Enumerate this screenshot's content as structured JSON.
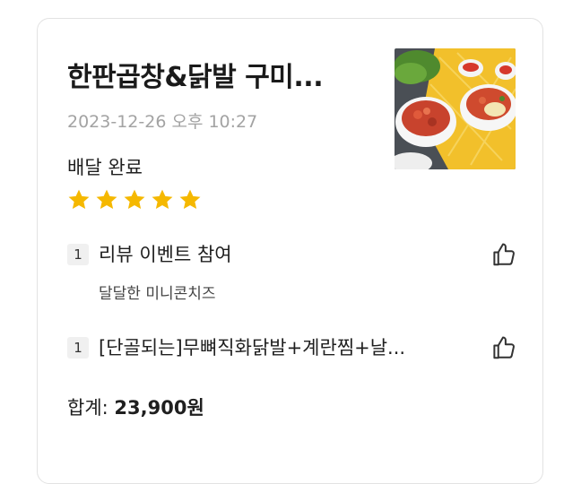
{
  "order": {
    "store_name": "한판곱창&닭발 구미...",
    "date": "2023-12-26 오후 10:27",
    "status": "배달 완료",
    "rating": 5,
    "items": [
      {
        "qty": "1",
        "name": "리뷰 이벤트 참여",
        "option": "달달한 미니콘치즈"
      },
      {
        "qty": "1",
        "name": "[단골되는]무뼈직화닭발+계란찜+날..."
      }
    ],
    "total_label": "합계:",
    "total_amount": "23,900원"
  },
  "colors": {
    "star": "#f5b800",
    "muted_text": "#a3a3a3",
    "card_border": "#e2e2e2"
  },
  "icons": {
    "thumbs_up": "thumbs-up-icon",
    "star": "star-icon"
  }
}
